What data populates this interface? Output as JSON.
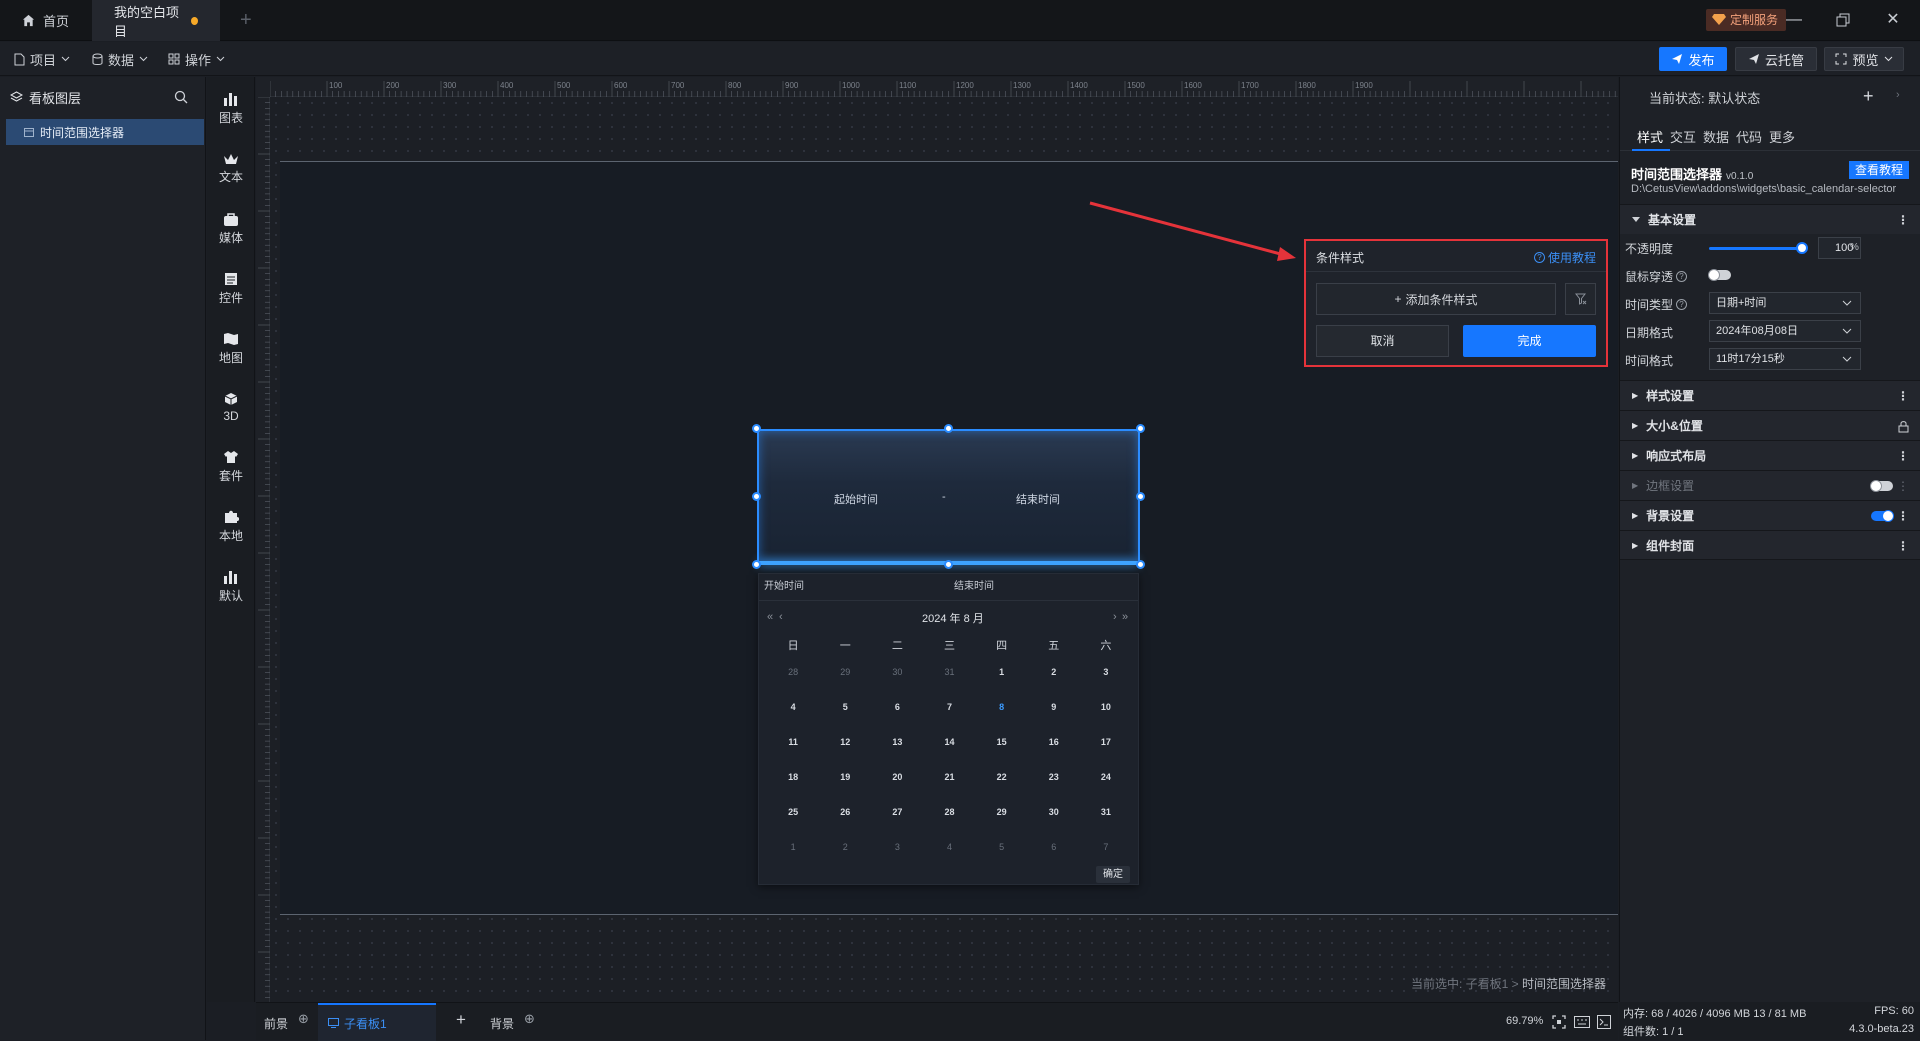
{
  "titlebar": {
    "home_tab": "首页",
    "project_tab": "我的空白项目",
    "custom_service": "定制服务"
  },
  "toolbar": {
    "menus": [
      "项目",
      "数据",
      "操作"
    ],
    "publish": "发布",
    "cloud": "云托管",
    "preview": "预览"
  },
  "layers": {
    "title": "看板图层",
    "item": "时间范围选择器"
  },
  "rail": [
    "图表",
    "文本",
    "媒体",
    "控件",
    "地图",
    "3D",
    "套件",
    "本地",
    "默认"
  ],
  "ruler": {
    "top": [
      "100",
      "200",
      "300",
      "400",
      "500",
      "600",
      "700",
      "800",
      "900",
      "1000",
      "1100",
      "1200",
      "1300",
      "1400",
      "1500",
      "1600",
      "1700",
      "1800",
      "1900"
    ]
  },
  "selector": {
    "start": "起始时间",
    "sep": "-",
    "end": "结束时间"
  },
  "calendar": {
    "start_label": "开始时间",
    "end_label": "结束时间",
    "month": "2024 年 8 月",
    "weekdays": [
      "日",
      "一",
      "二",
      "三",
      "四",
      "五",
      "六"
    ],
    "days": [
      "28",
      "29",
      "30",
      "31",
      "1",
      "2",
      "3",
      "4",
      "5",
      "6",
      "7",
      "8",
      "9",
      "10",
      "11",
      "12",
      "13",
      "14",
      "15",
      "16",
      "17",
      "18",
      "19",
      "20",
      "21",
      "22",
      "23",
      "24",
      "25",
      "26",
      "27",
      "28",
      "29",
      "30",
      "31",
      "1",
      "2",
      "3",
      "4",
      "5",
      "6",
      "7"
    ],
    "muted_index": [
      0,
      1,
      2,
      3,
      35,
      36,
      37,
      38,
      39,
      40,
      41
    ],
    "today_index": 11,
    "ok": "确定"
  },
  "condition_popup": {
    "title": "条件样式",
    "help": "使用教程",
    "add": "添加条件样式",
    "cancel": "取消",
    "done": "完成"
  },
  "breadcrumb": {
    "prefix": "当前选中: 子看板1 > ",
    "current": "时间范围选择器"
  },
  "right_panel": {
    "state": "当前状态:  默认状态",
    "tabs": [
      "样式",
      "交互",
      "数据",
      "代码",
      "更多"
    ],
    "component_title": "时间范围选择器",
    "version": "v0.1.0",
    "tutorial_button": "查看教程",
    "path": "D:\\CetusView\\addons\\widgets\\basic_calendar-selector",
    "basic_section": "基本设置",
    "opacity_label": "不透明度",
    "opacity_value": "100",
    "opacity_unit": "%",
    "mouse_label": "鼠标穿透",
    "time_type_label": "时间类型",
    "time_type_value": "日期+时间",
    "date_format_label": "日期格式",
    "date_format_value": "2024年08月08日",
    "time_format_label": "时间格式",
    "time_format_value": "11时17分15秒",
    "sections": [
      "样式设置",
      "大小&位置",
      "响应式布局",
      "边框设置",
      "背景设置",
      "组件封面"
    ]
  },
  "bottombar": {
    "foreground": "前景",
    "board": "子看板1",
    "background": "背景",
    "zoom": "69.79%"
  },
  "status": {
    "memory": "内存: 68 / 4026 / 4096 MB  13 / 81 MB",
    "fps": "FPS: 60",
    "components": "组件数: 1 / 1",
    "version": "4.3.0-beta.23"
  },
  "colors": {
    "accent": "#1677ff",
    "highlight": "#e5333a",
    "selection": "#2b8cff"
  }
}
